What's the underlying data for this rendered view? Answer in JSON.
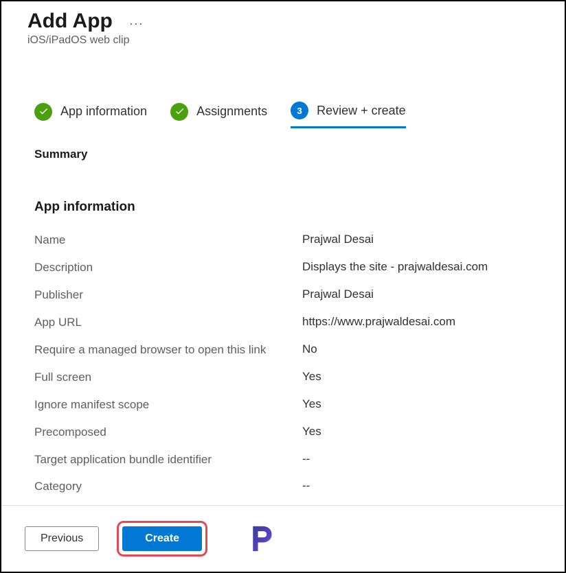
{
  "header": {
    "title": "Add App",
    "subtitle": "iOS/iPadOS web clip"
  },
  "steps": [
    {
      "label": "App information",
      "state": "complete"
    },
    {
      "label": "Assignments",
      "state": "complete"
    },
    {
      "number": "3",
      "label": "Review + create",
      "state": "active"
    }
  ],
  "summary": {
    "heading": "Summary",
    "section_title": "App information",
    "rows": [
      {
        "label": "Name",
        "value": "Prajwal Desai"
      },
      {
        "label": "Description",
        "value": "Displays the site - prajwaldesai.com"
      },
      {
        "label": "Publisher",
        "value": "Prajwal Desai"
      },
      {
        "label": "App URL",
        "value": "https://www.prajwaldesai.com"
      },
      {
        "label": "Require a managed browser to open this link",
        "value": "No"
      },
      {
        "label": "Full screen",
        "value": "Yes"
      },
      {
        "label": "Ignore manifest scope",
        "value": "Yes"
      },
      {
        "label": "Precomposed",
        "value": "Yes"
      },
      {
        "label": "Target application bundle identifier",
        "value": "--"
      },
      {
        "label": "Category",
        "value": "--"
      }
    ]
  },
  "footer": {
    "previous": "Previous",
    "create": "Create"
  }
}
